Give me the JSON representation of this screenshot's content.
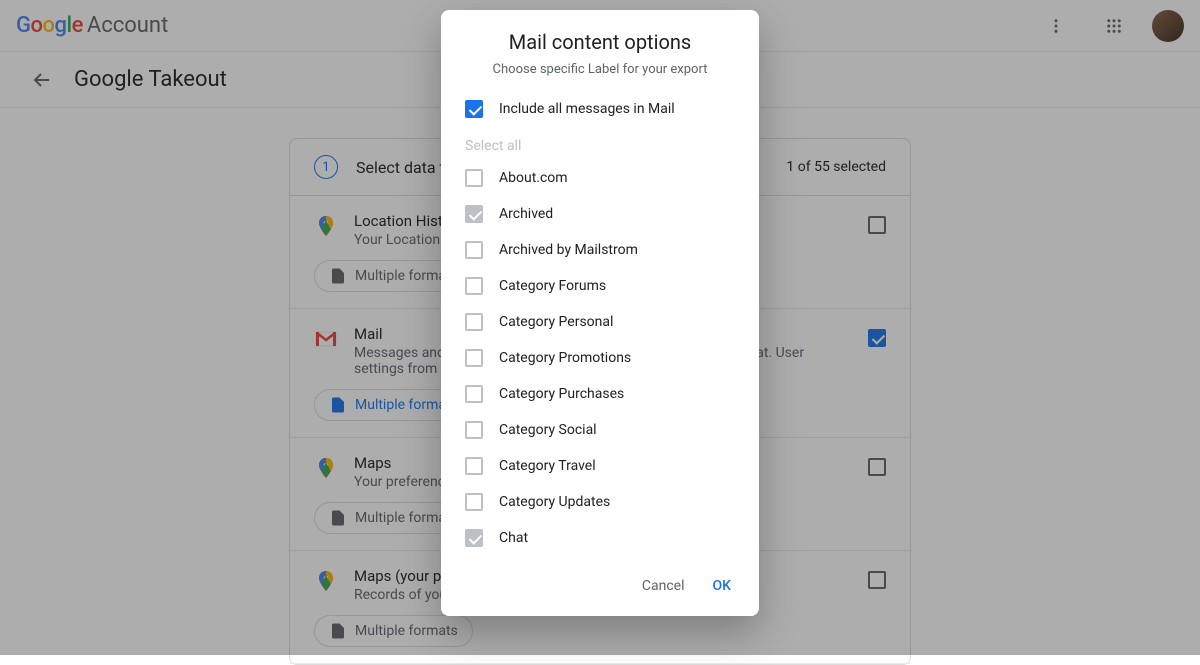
{
  "header": {
    "logo_google": "Google",
    "logo_account": "Account"
  },
  "subheader": {
    "title": "Google Takeout"
  },
  "step": {
    "number": "1",
    "title": "Select data to include",
    "count_text": "1 of 55 selected"
  },
  "products": {
    "location": {
      "name": "Location History",
      "desc": "Your Location History data including settings and visited history.",
      "chip": "Multiple formats"
    },
    "mail": {
      "name": "Mail",
      "desc": "Messages and attachments in your Gmail account in MBOX format. User settings from your account in JSON format.",
      "chip": "Multiple formats"
    },
    "maps": {
      "name": "Maps",
      "desc": "Your preferences and personal places in Maps.",
      "chip": "Multiple formats"
    },
    "maps_places": {
      "name": "Maps (your places)",
      "desc": "Records of your starred places and place reviews.",
      "chip": "Multiple formats"
    }
  },
  "dialog": {
    "title": "Mail content options",
    "subtitle": "Choose specific Label for your export",
    "include_all": "Include all messages in Mail",
    "select_all": "Select all",
    "labels": [
      "About.com",
      "Archived",
      "Archived by Mailstrom",
      "Category Forums",
      "Category Personal",
      "Category Promotions",
      "Category Purchases",
      "Category Social",
      "Category Travel",
      "Category Updates",
      "Chat"
    ],
    "label_states": [
      "empty",
      "checked",
      "empty",
      "empty",
      "empty",
      "empty",
      "empty",
      "empty",
      "empty",
      "empty",
      "checked"
    ],
    "cancel": "Cancel",
    "ok": "OK"
  }
}
